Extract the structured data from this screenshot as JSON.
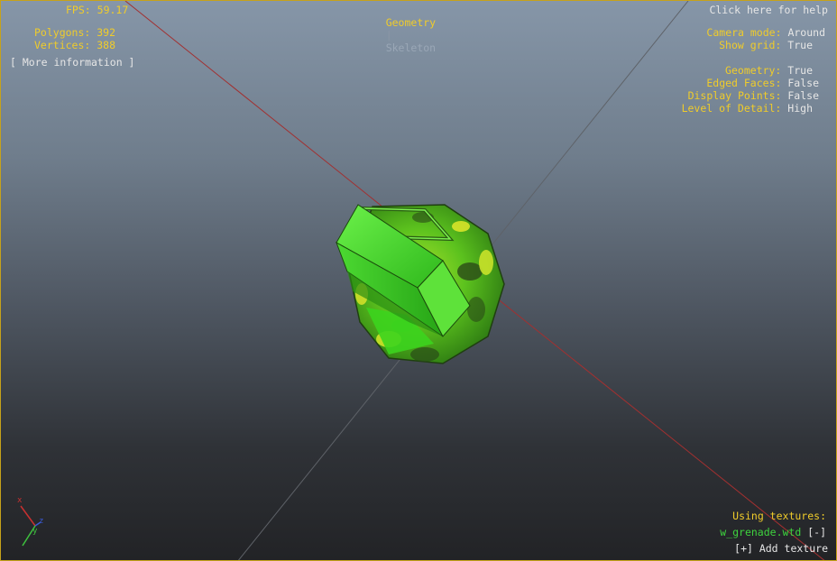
{
  "stats": {
    "fps_label": "FPS:",
    "fps_value": "59.17",
    "polygons_label": "Polygons:",
    "polygons_value": "392",
    "vertices_label": "Vertices:",
    "vertices_value": "388",
    "more_info": "[ More information ]"
  },
  "view_modes": {
    "active": "Geometry",
    "separator": "|",
    "inactive": "Skeleton"
  },
  "help": "Click here for help",
  "settings": [
    {
      "label": "Camera mode:",
      "value": "Around"
    },
    {
      "label": "Show grid:",
      "value": "True"
    },
    {
      "label": "Geometry:",
      "value": "True"
    },
    {
      "label": "Edged Faces:",
      "value": "False"
    },
    {
      "label": "Display Points:",
      "value": "False"
    },
    {
      "label": "Level of Detail:",
      "value": "High"
    }
  ],
  "textures": {
    "heading": "Using textures:",
    "file": "w_grenade.wtd",
    "remove": "[-]",
    "add": "[+] Add texture"
  },
  "axes": {
    "x": "x",
    "z": "z",
    "y": "y"
  },
  "colors": {
    "label": "#f0cc2a",
    "value": "#e6e6e6",
    "model_green": "#41e024",
    "grid_x_line": "#b52a2a",
    "grid_z_line": "#6a6a6a"
  }
}
